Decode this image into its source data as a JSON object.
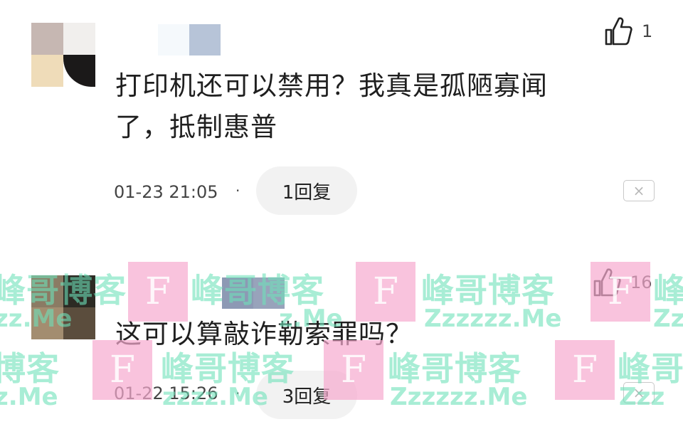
{
  "comments": [
    {
      "text_line1": "打印机还可以禁用？我真是孤陋寡闻",
      "text_line2": "了，抵制惠普",
      "time": "01-23 21:05",
      "separator": "·",
      "reply_label": "1回复",
      "like_count": "1",
      "close_symbol": "×"
    },
    {
      "text_line1": "这可以算敲诈勒索罪吗？",
      "text_line2": "",
      "time": "01-22 15:26",
      "separator": "·",
      "reply_label": "3回复",
      "like_count": "16",
      "close_symbol": "×"
    }
  ],
  "watermark": {
    "logo_letter": "F",
    "cn_text": "峰哥博客",
    "en_text": "Zzzzzz.Me",
    "cn_partial": "哥博客",
    "en_partial": "zzzz.Me",
    "cn_tail": "峰哥",
    "cn_tail2": "峰",
    "en_tail": "Zz",
    "en_tail2": "Zzz",
    "cn_frag": "博客",
    "en_frag": "z.Me",
    "en_frag2": "zz.Me"
  },
  "colors": {
    "pill_bg": "#f2f2f2",
    "watermark_pink": "#f6aace",
    "watermark_green": "#6ee1b9"
  }
}
